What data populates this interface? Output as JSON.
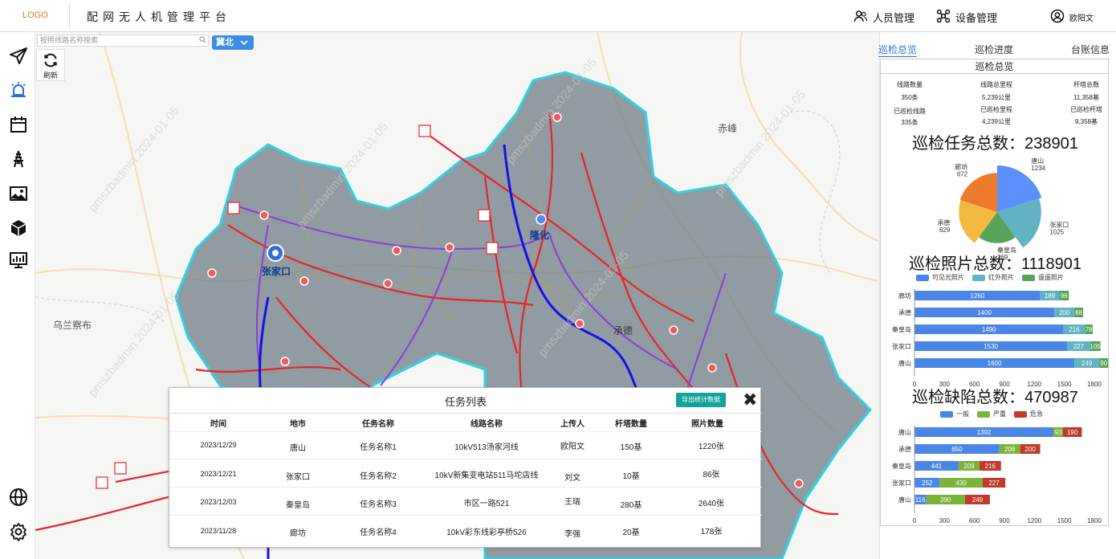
{
  "header": {
    "logo": "LOGO",
    "title": "配网无人机管理平台",
    "personnel_label": "人员管理",
    "device_label": "设备管理",
    "user_name": "欧阳文"
  },
  "search": {
    "placeholder": "按照线路名称搜索"
  },
  "region": {
    "selected": "冀北"
  },
  "refresh_label": "刷新",
  "map_labels": {
    "zhangjiakou": "张家口",
    "longhua": "隆化",
    "chengde": "承德",
    "chifeng": "赤峰",
    "wulanchabu": "乌兰察布",
    "watermark_text": "pmszbadmin 2024-01-05"
  },
  "tabs": [
    {
      "label": "巡检总览",
      "active": true
    },
    {
      "label": "巡检进度",
      "active": false
    },
    {
      "label": "台账信息",
      "active": false
    }
  ],
  "overview": {
    "card_title": "巡检总览",
    "stats": [
      {
        "label": "线路数量",
        "value": "350条"
      },
      {
        "label": "线路总里程",
        "value": "5,239公里"
      },
      {
        "label": "杆塔总数",
        "value": "11,358基"
      },
      {
        "label": "已巡检线路",
        "value": "335条"
      },
      {
        "label": "已巡检里程",
        "value": "4,239公里"
      },
      {
        "label": "已巡检杆塔",
        "value": "9,358基"
      }
    ],
    "task_total_label": "巡检任务总数：238901",
    "photo_total_label": "巡检照片总数：1118901",
    "defect_total_label": "巡检缺陷总数：470987"
  },
  "pie_colors": [
    "#5b8ff9",
    "#61b3c4",
    "#57a35a",
    "#f3b941",
    "#ee7a2e"
  ],
  "chart_data": [
    {
      "type": "pie",
      "title": "巡检任务总数：238901",
      "categories": [
        "唐山",
        "张家口",
        "秦皇岛",
        "承德",
        "廊坊"
      ],
      "values": [
        1234,
        1025,
        269,
        629,
        672
      ]
    },
    {
      "type": "bar",
      "orientation": "horizontal",
      "stacked": true,
      "title": "巡检照片总数：1118901",
      "categories": [
        "廊坊",
        "承德",
        "秦皇岛",
        "张家口",
        "唐山"
      ],
      "series": [
        {
          "name": "可见光照片",
          "color": "#4a86e8",
          "values": [
            1260,
            1400,
            1490,
            1530,
            1600
          ]
        },
        {
          "name": "红外照片",
          "color": "#61b3c4",
          "values": [
            189,
            200,
            216,
            227,
            249
          ]
        },
        {
          "name": "遥遥照片",
          "color": "#57a35a",
          "values": [
            96,
            88,
            78,
            105,
            90
          ]
        }
      ],
      "xticks": [
        0,
        300,
        600,
        900,
        1200,
        1500,
        1800
      ],
      "xlim": [
        0,
        1800
      ]
    },
    {
      "type": "bar",
      "orientation": "horizontal",
      "stacked": true,
      "title": "巡检缺陷总数：470987",
      "categories": [
        "唐山",
        "承德",
        "秦皇岛",
        "张家口",
        "唐山"
      ],
      "series": [
        {
          "name": "一般",
          "color": "#4a86e8",
          "values": [
            1392,
            850,
            441,
            252,
            116
          ]
        },
        {
          "name": "严重",
          "color": "#7bb33a",
          "values": [
            93,
            208,
            209,
            430,
            390
          ]
        },
        {
          "name": "危急",
          "color": "#c0392b",
          "values": [
            190,
            200,
            216,
            227,
            249
          ]
        }
      ],
      "xticks": [
        0,
        300,
        600,
        900,
        1200,
        1500,
        1800
      ],
      "xlim": [
        0,
        1800
      ]
    }
  ],
  "task_list": {
    "title": "任务列表",
    "export_label": "导出统计数据",
    "close_label": "✖",
    "columns": [
      "时间",
      "地市",
      "任务名称",
      "线路名称",
      "上传人",
      "杆塔数量",
      "照片数量"
    ],
    "rows": [
      [
        "2023/12/29",
        "唐山",
        "任务名称1",
        "10kV513汤家河线",
        "欧阳文",
        "150基",
        "1220张"
      ],
      [
        "2023/12/21",
        "张家口",
        "任务名称2",
        "10kV新集变电站511马坨店线",
        "刘文",
        "10基",
        "86张"
      ],
      [
        "2023/12/03",
        "秦皇岛",
        "任务名称3",
        "市区一路521",
        "王瑞",
        "280基",
        "2640张"
      ],
      [
        "2023/11/28",
        "廊坊",
        "任务名称4",
        "10kV彩东线彩亭桥526",
        "李强",
        "20基",
        "178张"
      ]
    ]
  }
}
